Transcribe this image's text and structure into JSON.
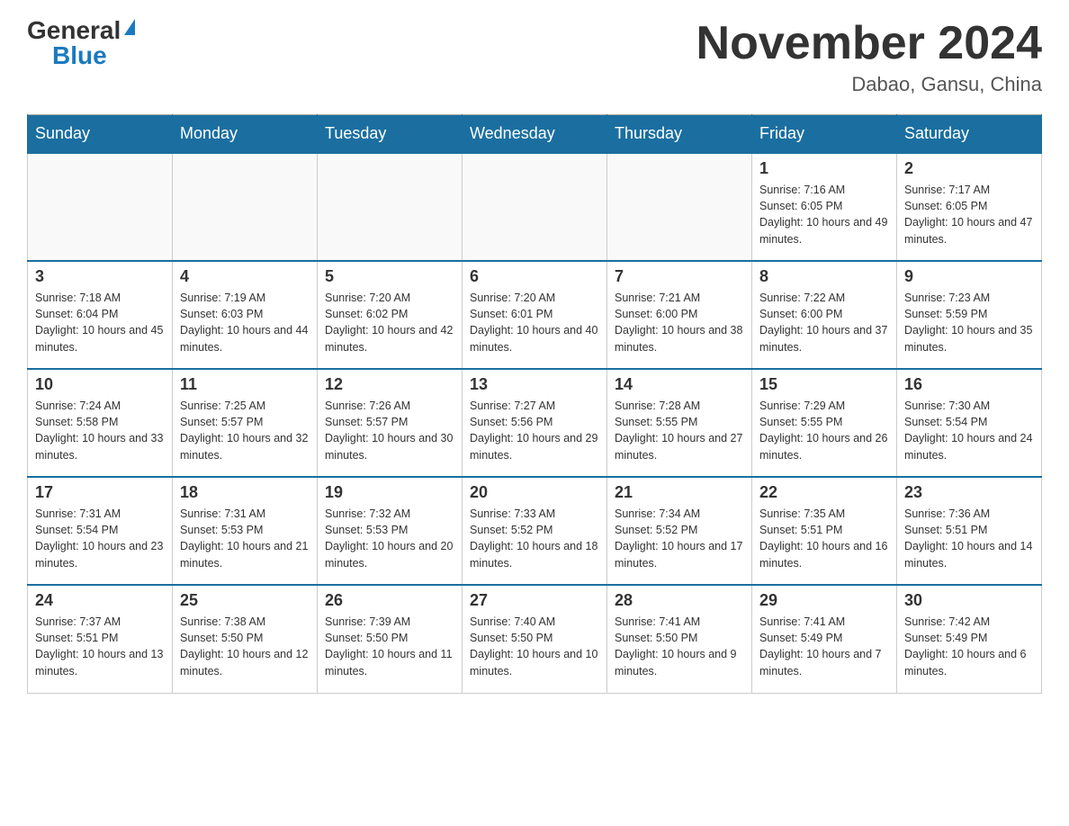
{
  "header": {
    "logo_general": "General",
    "logo_blue": "Blue",
    "month_title": "November 2024",
    "location": "Dabao, Gansu, China"
  },
  "weekdays": [
    "Sunday",
    "Monday",
    "Tuesday",
    "Wednesday",
    "Thursday",
    "Friday",
    "Saturday"
  ],
  "weeks": [
    [
      {
        "day": "",
        "sunrise": "",
        "sunset": "",
        "daylight": ""
      },
      {
        "day": "",
        "sunrise": "",
        "sunset": "",
        "daylight": ""
      },
      {
        "day": "",
        "sunrise": "",
        "sunset": "",
        "daylight": ""
      },
      {
        "day": "",
        "sunrise": "",
        "sunset": "",
        "daylight": ""
      },
      {
        "day": "",
        "sunrise": "",
        "sunset": "",
        "daylight": ""
      },
      {
        "day": "1",
        "sunrise": "Sunrise: 7:16 AM",
        "sunset": "Sunset: 6:05 PM",
        "daylight": "Daylight: 10 hours and 49 minutes."
      },
      {
        "day": "2",
        "sunrise": "Sunrise: 7:17 AM",
        "sunset": "Sunset: 6:05 PM",
        "daylight": "Daylight: 10 hours and 47 minutes."
      }
    ],
    [
      {
        "day": "3",
        "sunrise": "Sunrise: 7:18 AM",
        "sunset": "Sunset: 6:04 PM",
        "daylight": "Daylight: 10 hours and 45 minutes."
      },
      {
        "day": "4",
        "sunrise": "Sunrise: 7:19 AM",
        "sunset": "Sunset: 6:03 PM",
        "daylight": "Daylight: 10 hours and 44 minutes."
      },
      {
        "day": "5",
        "sunrise": "Sunrise: 7:20 AM",
        "sunset": "Sunset: 6:02 PM",
        "daylight": "Daylight: 10 hours and 42 minutes."
      },
      {
        "day": "6",
        "sunrise": "Sunrise: 7:20 AM",
        "sunset": "Sunset: 6:01 PM",
        "daylight": "Daylight: 10 hours and 40 minutes."
      },
      {
        "day": "7",
        "sunrise": "Sunrise: 7:21 AM",
        "sunset": "Sunset: 6:00 PM",
        "daylight": "Daylight: 10 hours and 38 minutes."
      },
      {
        "day": "8",
        "sunrise": "Sunrise: 7:22 AM",
        "sunset": "Sunset: 6:00 PM",
        "daylight": "Daylight: 10 hours and 37 minutes."
      },
      {
        "day": "9",
        "sunrise": "Sunrise: 7:23 AM",
        "sunset": "Sunset: 5:59 PM",
        "daylight": "Daylight: 10 hours and 35 minutes."
      }
    ],
    [
      {
        "day": "10",
        "sunrise": "Sunrise: 7:24 AM",
        "sunset": "Sunset: 5:58 PM",
        "daylight": "Daylight: 10 hours and 33 minutes."
      },
      {
        "day": "11",
        "sunrise": "Sunrise: 7:25 AM",
        "sunset": "Sunset: 5:57 PM",
        "daylight": "Daylight: 10 hours and 32 minutes."
      },
      {
        "day": "12",
        "sunrise": "Sunrise: 7:26 AM",
        "sunset": "Sunset: 5:57 PM",
        "daylight": "Daylight: 10 hours and 30 minutes."
      },
      {
        "day": "13",
        "sunrise": "Sunrise: 7:27 AM",
        "sunset": "Sunset: 5:56 PM",
        "daylight": "Daylight: 10 hours and 29 minutes."
      },
      {
        "day": "14",
        "sunrise": "Sunrise: 7:28 AM",
        "sunset": "Sunset: 5:55 PM",
        "daylight": "Daylight: 10 hours and 27 minutes."
      },
      {
        "day": "15",
        "sunrise": "Sunrise: 7:29 AM",
        "sunset": "Sunset: 5:55 PM",
        "daylight": "Daylight: 10 hours and 26 minutes."
      },
      {
        "day": "16",
        "sunrise": "Sunrise: 7:30 AM",
        "sunset": "Sunset: 5:54 PM",
        "daylight": "Daylight: 10 hours and 24 minutes."
      }
    ],
    [
      {
        "day": "17",
        "sunrise": "Sunrise: 7:31 AM",
        "sunset": "Sunset: 5:54 PM",
        "daylight": "Daylight: 10 hours and 23 minutes."
      },
      {
        "day": "18",
        "sunrise": "Sunrise: 7:31 AM",
        "sunset": "Sunset: 5:53 PM",
        "daylight": "Daylight: 10 hours and 21 minutes."
      },
      {
        "day": "19",
        "sunrise": "Sunrise: 7:32 AM",
        "sunset": "Sunset: 5:53 PM",
        "daylight": "Daylight: 10 hours and 20 minutes."
      },
      {
        "day": "20",
        "sunrise": "Sunrise: 7:33 AM",
        "sunset": "Sunset: 5:52 PM",
        "daylight": "Daylight: 10 hours and 18 minutes."
      },
      {
        "day": "21",
        "sunrise": "Sunrise: 7:34 AM",
        "sunset": "Sunset: 5:52 PM",
        "daylight": "Daylight: 10 hours and 17 minutes."
      },
      {
        "day": "22",
        "sunrise": "Sunrise: 7:35 AM",
        "sunset": "Sunset: 5:51 PM",
        "daylight": "Daylight: 10 hours and 16 minutes."
      },
      {
        "day": "23",
        "sunrise": "Sunrise: 7:36 AM",
        "sunset": "Sunset: 5:51 PM",
        "daylight": "Daylight: 10 hours and 14 minutes."
      }
    ],
    [
      {
        "day": "24",
        "sunrise": "Sunrise: 7:37 AM",
        "sunset": "Sunset: 5:51 PM",
        "daylight": "Daylight: 10 hours and 13 minutes."
      },
      {
        "day": "25",
        "sunrise": "Sunrise: 7:38 AM",
        "sunset": "Sunset: 5:50 PM",
        "daylight": "Daylight: 10 hours and 12 minutes."
      },
      {
        "day": "26",
        "sunrise": "Sunrise: 7:39 AM",
        "sunset": "Sunset: 5:50 PM",
        "daylight": "Daylight: 10 hours and 11 minutes."
      },
      {
        "day": "27",
        "sunrise": "Sunrise: 7:40 AM",
        "sunset": "Sunset: 5:50 PM",
        "daylight": "Daylight: 10 hours and 10 minutes."
      },
      {
        "day": "28",
        "sunrise": "Sunrise: 7:41 AM",
        "sunset": "Sunset: 5:50 PM",
        "daylight": "Daylight: 10 hours and 9 minutes."
      },
      {
        "day": "29",
        "sunrise": "Sunrise: 7:41 AM",
        "sunset": "Sunset: 5:49 PM",
        "daylight": "Daylight: 10 hours and 7 minutes."
      },
      {
        "day": "30",
        "sunrise": "Sunrise: 7:42 AM",
        "sunset": "Sunset: 5:49 PM",
        "daylight": "Daylight: 10 hours and 6 minutes."
      }
    ]
  ]
}
